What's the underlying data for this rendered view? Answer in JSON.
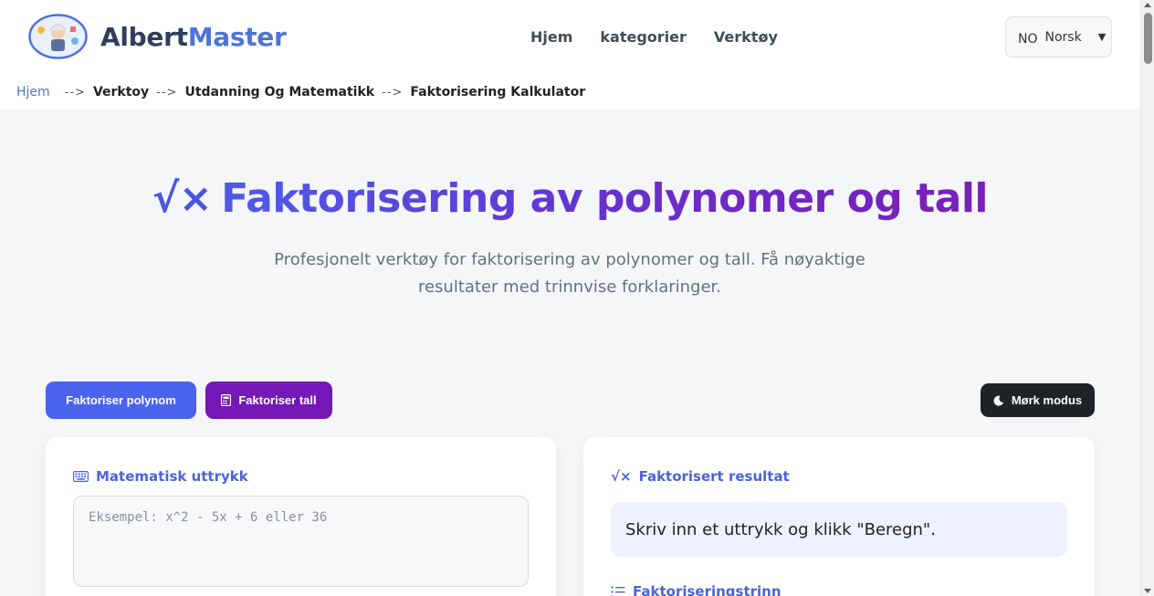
{
  "header": {
    "brand_part1": "Albert",
    "brand_part2": "Master",
    "nav": [
      "Hjem",
      "kategorier",
      "Verktøy"
    ],
    "language": {
      "code": "NO",
      "label": "Norsk",
      "caret": "▼"
    }
  },
  "breadcrumb": {
    "home": "Hjem",
    "separator": "-->",
    "items": [
      "Verktoy",
      "Utdanning Og Matematikk",
      "Faktorisering Kalkulator"
    ]
  },
  "hero": {
    "icon": "√×",
    "title": "Faktorisering av polynomer og tall",
    "subtitle": "Profesjonelt verktøy for faktorisering av polynomer og tall. Få nøyaktige resultater med trinnvise forklaringer."
  },
  "actions": {
    "factor_polynomial": "Faktoriser polynom",
    "factor_number": "Faktoriser tall",
    "dark_mode": "Mørk modus"
  },
  "input_card": {
    "label": "Matematisk uttrykk",
    "value": "",
    "placeholder": "Eksempel: x^2 - 5x + 6 eller 36"
  },
  "result_card": {
    "label": "Faktorisert resultat",
    "message": "Skriv inn et uttrykk og klikk \"Beregn\".",
    "steps_label": "Faktoriseringstrinn"
  },
  "colors": {
    "accent": "#4b62ee",
    "purple": "#7418b8",
    "dark": "#1f2328",
    "result_bg": "#eef1fe"
  }
}
